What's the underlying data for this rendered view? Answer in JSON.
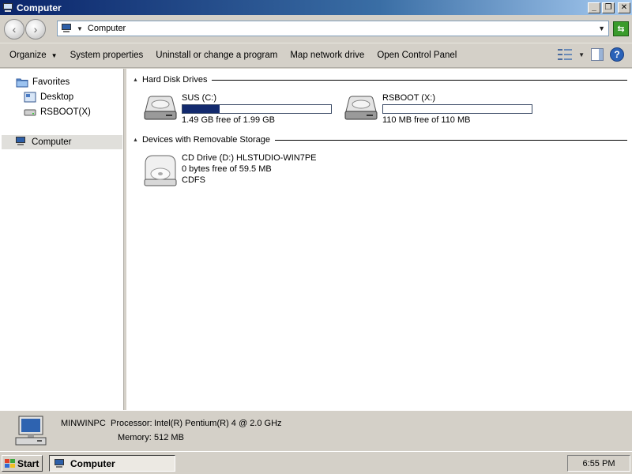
{
  "window": {
    "title": "Computer"
  },
  "address": {
    "location": "Computer"
  },
  "toolbar": {
    "organize": "Organize",
    "system_properties": "System properties",
    "uninstall": "Uninstall or change a program",
    "map_network_drive": "Map network drive",
    "open_control_panel": "Open Control Panel"
  },
  "nav": {
    "favorites": "Favorites",
    "desktop": "Desktop",
    "rsboot": "RSBOOT(X)",
    "computer": "Computer"
  },
  "groups": {
    "hard_disks": "Hard Disk Drives",
    "removable": "Devices with Removable Storage"
  },
  "drives": {
    "c": {
      "name": "SUS (C:)",
      "free_text": "1.49 GB free of 1.99 GB",
      "used_fraction": 0.25
    },
    "x": {
      "name": "RSBOOT (X:)",
      "free_text": "110 MB free of 110 MB",
      "used_fraction": 0.0
    },
    "d": {
      "name": "CD Drive (D:) HLSTUDIO-WIN7PE",
      "free_text": "0 bytes free of 59.5 MB",
      "fs": "CDFS"
    }
  },
  "details": {
    "computer_name": "MINWINPC",
    "processor_label": "Processor:",
    "processor_value": "Intel(R) Pentium(R) 4   @ 2.0 GHz",
    "memory_label": "Memory:",
    "memory_value": "512 MB"
  },
  "taskbar": {
    "start": "Start",
    "task_computer": "Computer",
    "clock": "6:55 PM"
  },
  "colors": {
    "usage_bar": "#132a6e",
    "title_start": "#0a246a"
  }
}
